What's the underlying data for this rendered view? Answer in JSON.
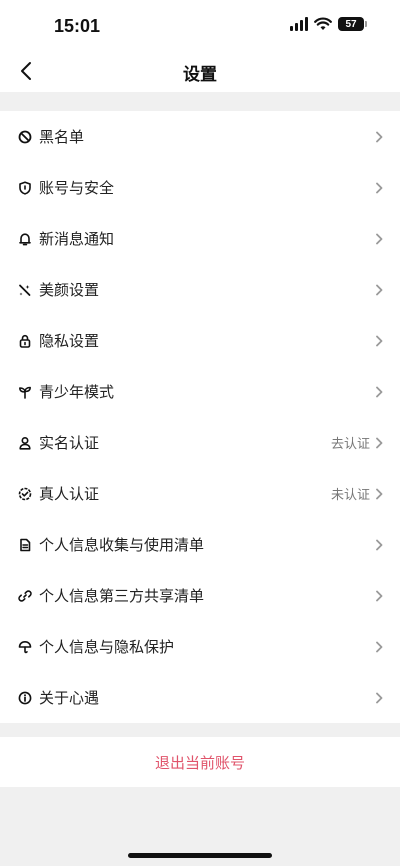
{
  "status_bar": {
    "time": "15:01",
    "battery": "57"
  },
  "header": {
    "title": "设置"
  },
  "menu": [
    {
      "label": "黑名单",
      "icon": "block-icon",
      "status": ""
    },
    {
      "label": "账号与安全",
      "icon": "shield-icon",
      "status": ""
    },
    {
      "label": "新消息通知",
      "icon": "bell-icon",
      "status": ""
    },
    {
      "label": "美颜设置",
      "icon": "beauty-wand-icon",
      "status": ""
    },
    {
      "label": "隐私设置",
      "icon": "lock-icon",
      "status": ""
    },
    {
      "label": "青少年模式",
      "icon": "sprout-icon",
      "status": ""
    },
    {
      "label": "实名认证",
      "icon": "person-icon",
      "status": "去认证"
    },
    {
      "label": "真人认证",
      "icon": "verified-check-icon",
      "status": "未认证"
    },
    {
      "label": "个人信息收集与使用清单",
      "icon": "document-icon",
      "status": ""
    },
    {
      "label": "个人信息第三方共享清单",
      "icon": "link-icon",
      "status": ""
    },
    {
      "label": "个人信息与隐私保护",
      "icon": "umbrella-icon",
      "status": ""
    },
    {
      "label": "关于心遇",
      "icon": "info-circle-icon",
      "status": ""
    }
  ],
  "logout": {
    "label": "退出当前账号"
  },
  "colors": {
    "accent": "#e0546b",
    "background": "#f0f0f0",
    "card": "#ffffff"
  }
}
